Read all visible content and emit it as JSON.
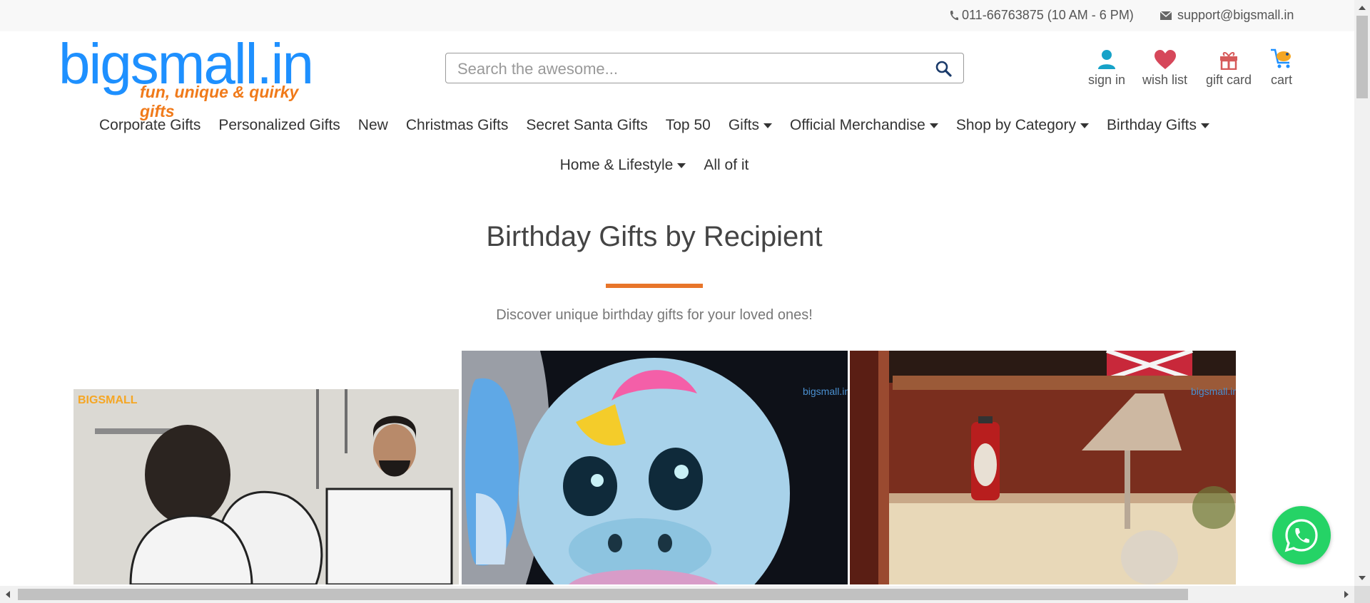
{
  "topbar": {
    "phone": "011-66763875 (10 AM - 6 PM)",
    "email": "support@bigsmall.in"
  },
  "logo": {
    "word": "bigsmall.in",
    "tagline": "fun, unique & quirky gifts"
  },
  "search": {
    "placeholder": "Search the awesome..."
  },
  "account": {
    "sign_in": "sign in",
    "wish_list": "wish list",
    "gift_card": "gift card",
    "cart": "cart"
  },
  "nav": {
    "row1": [
      {
        "label": "Corporate Gifts",
        "dropdown": false
      },
      {
        "label": "Personalized Gifts",
        "dropdown": false
      },
      {
        "label": "New",
        "dropdown": false
      },
      {
        "label": "Christmas Gifts",
        "dropdown": false
      },
      {
        "label": "Secret Santa Gifts",
        "dropdown": false
      },
      {
        "label": "Top 50",
        "dropdown": false
      },
      {
        "label": "Gifts",
        "dropdown": true
      },
      {
        "label": "Official Merchandise",
        "dropdown": true
      },
      {
        "label": "Shop by Category",
        "dropdown": true
      },
      {
        "label": "Birthday Gifts",
        "dropdown": true
      }
    ],
    "row2": [
      {
        "label": "Home & Lifestyle",
        "dropdown": true
      },
      {
        "label": "All of it",
        "dropdown": false
      }
    ]
  },
  "section": {
    "title": "Birthday Gifts by Recipient",
    "subtitle": "Discover unique birthday gifts for your loved ones!"
  },
  "cards": {
    "card1_watermark": "BIGSMALL",
    "card2_watermark": "bigsmall.in",
    "card3_watermark": "bigsmall.in"
  },
  "colors": {
    "brand_blue": "#1e90ff",
    "brand_orange": "#f07a1a",
    "accent_rule": "#e8752a",
    "whatsapp_green": "#25d366"
  }
}
